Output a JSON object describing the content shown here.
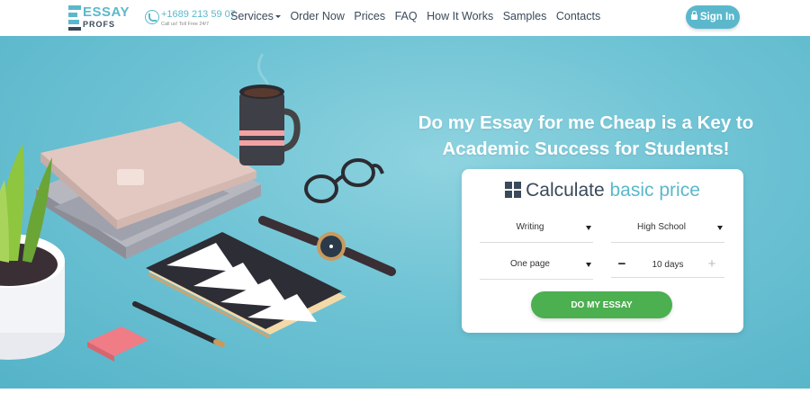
{
  "header": {
    "logo_top": "ESSAY",
    "logo_bottom": "PROFS",
    "phone_number": "+1689 213 59 07",
    "phone_sub": "Call us! Toll Free 24/7",
    "nav": [
      "Services",
      "Order Now",
      "Prices",
      "FAQ",
      "How It Works",
      "Samples",
      "Contacts"
    ],
    "signin_label": "Sign In"
  },
  "hero": {
    "headline": "Do my Essay for me Cheap is a Key to Academic Success for Students!"
  },
  "calculator": {
    "title_main": "Calculate",
    "title_accent": "basic price",
    "service_type": "Writing",
    "academic_level": "High School",
    "pages": "One page",
    "deadline": "10 days",
    "minus": "−",
    "plus": "+",
    "submit_label": "DO MY ESSAY"
  },
  "colors": {
    "accent": "#5bb8cc",
    "hero_bg": "#6ec3d4",
    "submit": "#4caf50",
    "text_dark": "#3a4a5a"
  },
  "icons": {
    "phone": "phone-icon",
    "lock": "lock-icon",
    "calculator": "calculator-icon",
    "dropdown": "chevron-down-icon"
  }
}
